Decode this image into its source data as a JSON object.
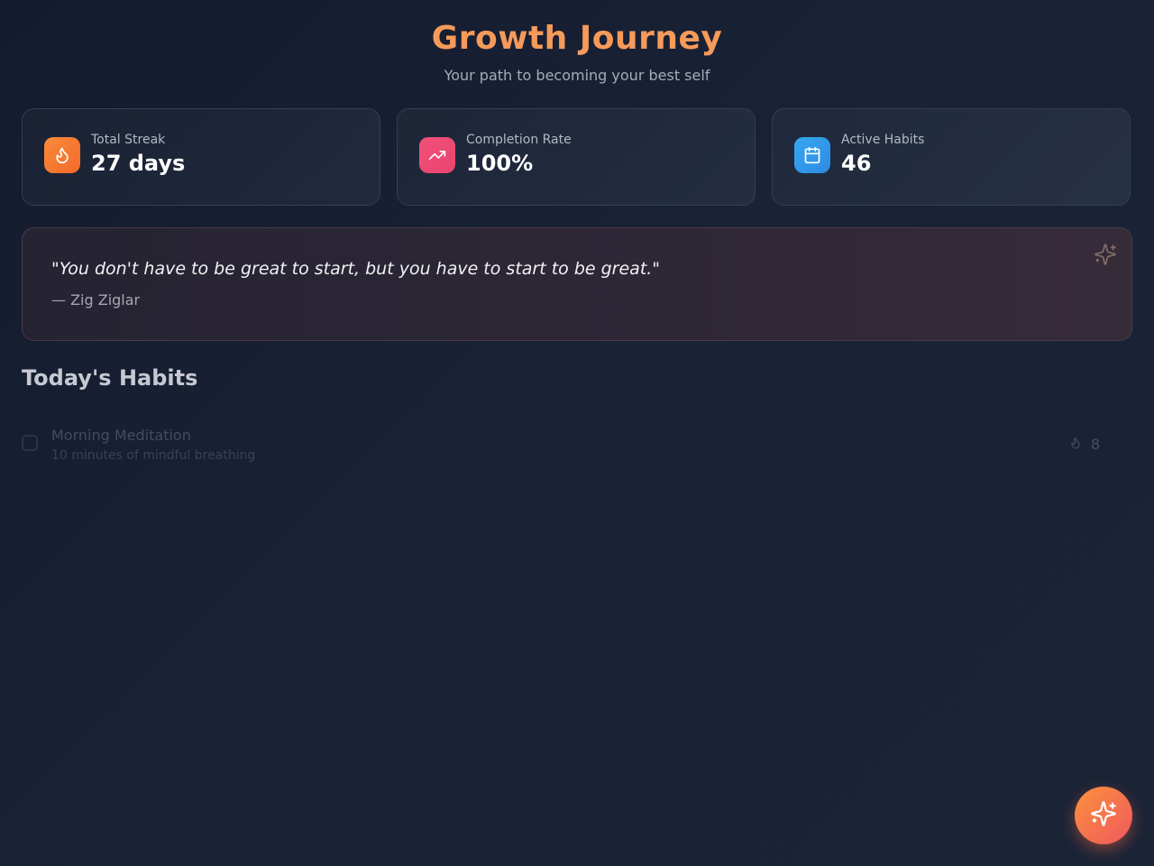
{
  "header": {
    "title": "Growth Journey",
    "subtitle": "Your path to becoming your best self"
  },
  "stats": [
    {
      "label": "Total Streak",
      "value": "27 days",
      "icon": "flame-icon",
      "color": "#f97a34"
    },
    {
      "label": "Completion Rate",
      "value": "100%",
      "icon": "trending-up-icon",
      "color": "#ee4c75"
    },
    {
      "label": "Active Habits",
      "value": "46",
      "icon": "calendar-icon",
      "color": "#3399ea"
    }
  ],
  "quote": {
    "text": "\"You don't have to be great to start, but you have to start to be great.\"",
    "author": "— Zig Ziglar"
  },
  "habits_section": {
    "title": "Today's Habits",
    "items": [
      {
        "name": "Morning Meditation",
        "description": "10 minutes of mindful breathing",
        "streak": "8",
        "completed": false
      }
    ]
  },
  "colors": {
    "accent": "#f59a5a",
    "background": "#161d30"
  }
}
